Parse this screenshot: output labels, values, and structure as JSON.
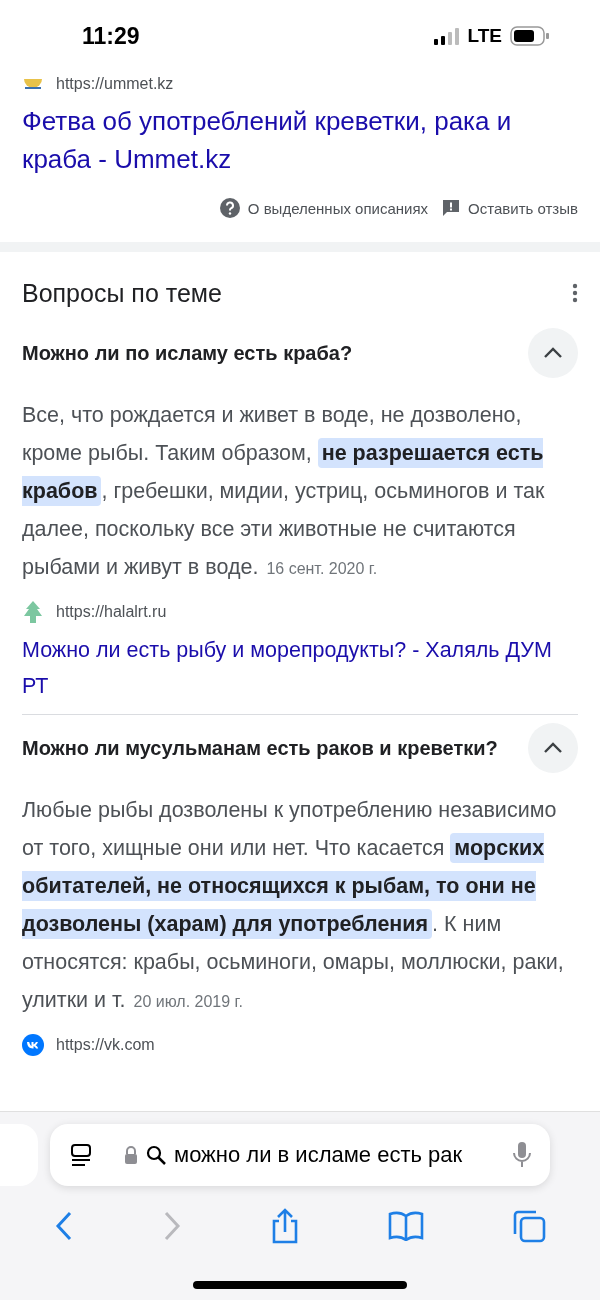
{
  "status_bar": {
    "time": "11:29",
    "network": "LTE"
  },
  "top_result": {
    "url": "https://ummet.kz",
    "title": "Фетва об употреблений креветки, рака и краба - Ummet.kz",
    "links": [
      {
        "kind": "about",
        "label": "О выделенных описаниях"
      },
      {
        "kind": "feedback",
        "label": "Оставить отзыв"
      }
    ]
  },
  "questions": {
    "heading": "Вопросы по теме",
    "items": [
      {
        "question": "Можно ли по исламу есть краба?",
        "expanded": true,
        "answer": "Все, что рождается и живет в воде, не дозволено, кроме рыбы. Таким образом, **не разрешается есть крабов**, гребешки, мидии, устриц, осьминогов и так далее, поскольку все эти животные не считаются рыбами и живут в воде.",
        "date": "16 сент. 2020 г.",
        "source": {
          "kind": "halal",
          "url": "https://halalrt.ru",
          "title": "Можно ли есть рыбу и морепродукты? - Халяль ДУМ РТ"
        }
      },
      {
        "question": "Можно ли мусульманам есть раков и креветки?",
        "expanded": true,
        "answer": "Любые рыбы дозволены к употреблению независимо от того, хищные они или нет. Что касается **морских обитателей, не относящихся к рыбам, то они не дозволены (харам) для употребления**. К ним относятся: крабы, осьминоги, омары, моллюски, раки, улитки и т.",
        "date": "20 июл. 2019 г.",
        "source": {
          "kind": "vk",
          "url": "https://vk.com"
        }
      }
    ]
  },
  "address_bar": {
    "value": "можно ли в исламе есть рак"
  }
}
